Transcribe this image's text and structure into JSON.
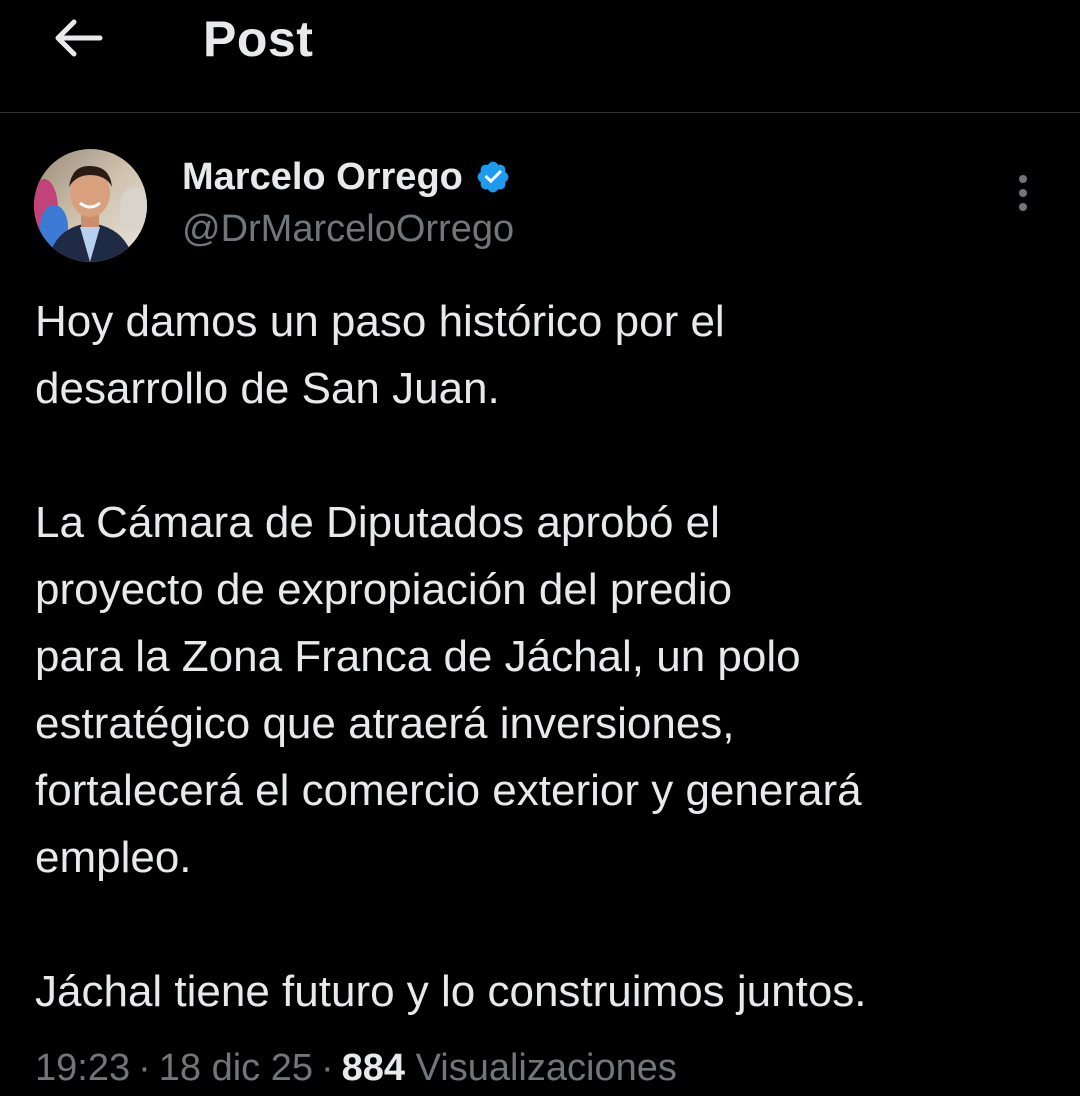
{
  "header": {
    "back_icon": "arrow-left-icon",
    "title": "Post"
  },
  "author": {
    "avatar": "avatar-photo",
    "name": "Marcelo Orrego",
    "verified_icon": "verified-badge-icon",
    "handle": "@DrMarceloOrrego",
    "more_icon": "more-vertical-icon"
  },
  "post": {
    "paragraphs": [
      "Hoy damos un paso histórico por el\ndesarrollo de San Juan.",
      "La Cámara de Diputados aprobó el\nproyecto de expropiación del predio\npara la Zona Franca de Jáchal, un polo\nestratégico que atraerá inversiones,\nfortalecerá el comercio exterior y generará\nempleo.",
      "Jáchal tiene futuro y lo construimos juntos."
    ]
  },
  "meta": {
    "time": "19:23",
    "separator": "·",
    "date": "18 dic 25",
    "views_count": "884",
    "views_label": "Visualizaciones"
  },
  "colors": {
    "background": "#000000",
    "text_primary": "#e7e9ea",
    "text_secondary": "#71767b",
    "verified_blue": "#1d9bf0",
    "divider": "#2f3336"
  }
}
